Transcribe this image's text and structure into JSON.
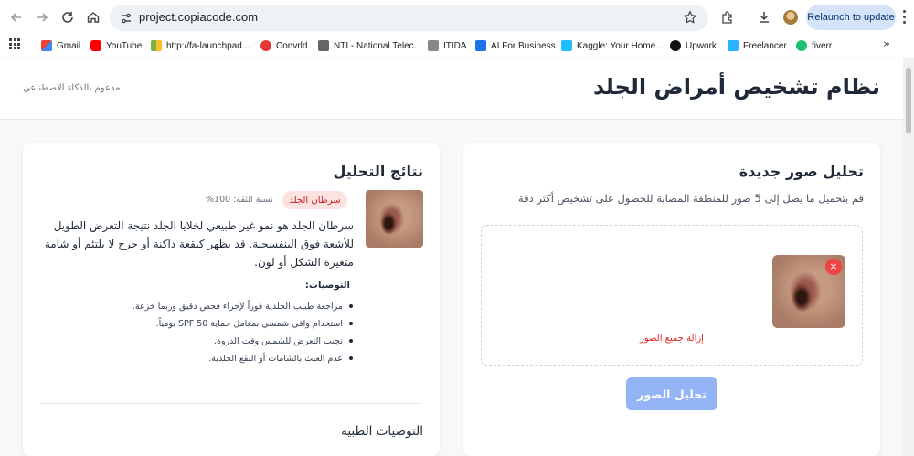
{
  "browser": {
    "url": "project.copiacode.com",
    "relaunch_label": "Relaunch to update",
    "bookmarks": [
      {
        "label": "Gmail",
        "icon": "gmail-icon",
        "color": "#ea4335"
      },
      {
        "label": "YouTube",
        "icon": "youtube-icon",
        "color": "#ff0000"
      },
      {
        "label": "http://fa-launchpad....",
        "icon": "launchpad-icon",
        "color": "#7cb342"
      },
      {
        "label": "Convrld",
        "icon": "convrld-icon",
        "color": "#e53935"
      },
      {
        "label": "NTI - National Telec...",
        "icon": "nti-icon",
        "color": "#555555"
      },
      {
        "label": "ITIDA",
        "icon": "itida-icon",
        "color": "#777777"
      },
      {
        "label": "AI For Business",
        "icon": "ai-business-icon",
        "color": "#1a73e8"
      },
      {
        "label": "Kaggle: Your Home...",
        "icon": "kaggle-icon",
        "color": "#20beff"
      },
      {
        "label": "Upwork",
        "icon": "upwork-icon",
        "color": "#111111"
      },
      {
        "label": "Freelancer",
        "icon": "freelancer-icon",
        "color": "#29b2fe"
      },
      {
        "label": "fiverr",
        "icon": "fiverr-icon",
        "color": "#1dbf73"
      }
    ]
  },
  "header": {
    "title": "نظام تشخيص أمراض الجلد",
    "subtitle": "مدعوم بالذكاء الاصطناعي"
  },
  "upload": {
    "title": "تحليل صور جديدة",
    "description": "قم بتحميل ما يصل إلى 5 صور للمنطقة المصابة للحصول على تشخيص أكثر دقة",
    "remove_icon": "×",
    "remove_all_label": "إزالة جميع الصور",
    "analyze_label": "تحليل الصور"
  },
  "results": {
    "title": "نتائج التحليل",
    "diagnosis": "سرطان الجلد",
    "confidence": "نسبة الثقة: 100%",
    "description": "سرطان الجلد هو نمو غير طبيعي لخلايا الجلد نتيجة التعرض الطويل للأشعة فوق البنفسجية. قد يظهر كبقعة داكنة أو جرح لا يلتئم أو شامة متغيرة الشكل أو لون.",
    "recommendations_heading": "التوصيات:",
    "recommendations": [
      "مراجعة طبيب الجلدية فوراً لإجراء فحص دقيق وربما خزعة.",
      "استخدام واقي شمسي بمعامل حماية SPF 50 يومياً.",
      "تجنب التعرض للشمس وقت الذروة.",
      "عدم العبث بالشامات أو البقع الجلدية."
    ],
    "medical_title": "التوصيات الطبية"
  }
}
